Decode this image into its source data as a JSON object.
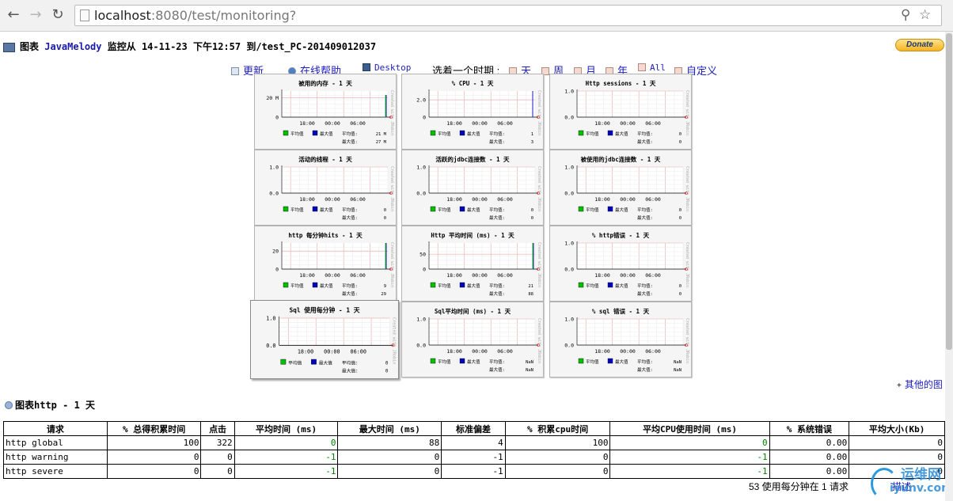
{
  "browser": {
    "url_host": "localhost",
    "url_path": ":8080/test/monitoring?"
  },
  "header": {
    "prefix": "图表",
    "app": "JavaMelody",
    "monitor_text": "监控从 14-11-23 下午12:57 到/test_PC-201409012037",
    "donate": "Donate"
  },
  "toolbar": {
    "refresh": "更新",
    "help": "在线帮助",
    "desktop": "Desktop",
    "period_label": "选着一个时期 :",
    "day": "天",
    "week": "周",
    "month": "月",
    "year": "年",
    "all": "All",
    "custom": "自定义"
  },
  "charts": [
    {
      "title": "被用的内存 - 1 天",
      "y_top": "20 M",
      "y_bottom": "0",
      "avg": "21 M",
      "max": "27 M",
      "spike": true,
      "spike_colors": [
        "#00c000",
        "#0000c0"
      ],
      "spike_height": 0.85,
      "y_top_frac": 0.74
    },
    {
      "title": "% CPU - 1 天",
      "y_top": "2.0",
      "y_bottom": "0",
      "avg": "1",
      "max": "3",
      "spike": true,
      "spike_colors": [
        "#0000c0"
      ],
      "spike_height": 1.0,
      "y_top_frac": 0.66
    },
    {
      "title": "Http sessions - 1 天",
      "y_top": "1.0",
      "y_bottom": "0.0",
      "avg": "0",
      "max": "0",
      "spike": false,
      "y_top_frac": 1.0
    },
    {
      "title": "活动的线程 - 1 天",
      "y_top": "1.0",
      "y_bottom": "0.0",
      "avg": "0",
      "max": "0",
      "spike": false,
      "y_top_frac": 1.0
    },
    {
      "title": "活跃的jdbc连接数 - 1 天",
      "y_top": "1.0",
      "y_bottom": "0.0",
      "avg": "0",
      "max": "0",
      "spike": false,
      "y_top_frac": 1.0
    },
    {
      "title": "被使用的jdbc连接数 - 1 天",
      "y_top": "1.0",
      "y_bottom": "0.0",
      "avg": "0",
      "max": "0",
      "spike": false,
      "y_top_frac": 1.0
    },
    {
      "title": "http 每分钟hits - 1 天",
      "y_top": "20",
      "y_bottom": "0",
      "avg": "9",
      "max": "29",
      "spike": true,
      "spike_colors": [
        "#00c000",
        "#0000c0"
      ],
      "spike_height": 1.0,
      "y_top_frac": 0.69
    },
    {
      "title": "Http 平均时间 (ms) - 1 天",
      "y_top": "50",
      "y_bottom": "0",
      "avg": "21",
      "max": "88",
      "spike": true,
      "spike_colors": [
        "#00c000",
        "#0000c0"
      ],
      "spike_height": 1.0,
      "y_top_frac": 0.57
    },
    {
      "title": "% http错误 - 1 天",
      "y_top": "1.0",
      "y_bottom": "0.0",
      "avg": "0",
      "max": "0",
      "spike": false,
      "y_top_frac": 1.0
    },
    {
      "title": "Sql 使用每分钟 - 1 天",
      "y_top": "1.0",
      "y_bottom": "0.0",
      "avg": "0",
      "max": "0",
      "spike": false,
      "y_top_frac": 1.0,
      "big": true
    },
    {
      "title": "Sql平均时间 (ms) - 1 天",
      "y_top": "1.0",
      "y_bottom": "0.0",
      "avg": "NaN",
      "max": "NaN",
      "spike": false,
      "y_top_frac": 1.0
    },
    {
      "title": "% sql 错误 - 1 天",
      "y_top": "1.0",
      "y_bottom": "0.0",
      "avg": "NaN",
      "max": "NaN",
      "spike": false,
      "y_top_frac": 1.0
    }
  ],
  "chart_common": {
    "x_ticks": [
      "18:00",
      "00:00",
      "06:00"
    ],
    "legend_avg": "平均值",
    "legend_max": "最大值",
    "avg_label": "平均值:",
    "max_label": "最大值:",
    "side_text": "Created with JRobin",
    "avg_color": "#00c000",
    "max_color": "#0000c0"
  },
  "other_charts": "其他的图",
  "section_title": "图表http - 1 天",
  "table": {
    "headers": [
      "请求",
      "% 总得积累时间",
      "点击",
      "平均时间 (ms)",
      "最大时间 (ms)",
      "标准偏差",
      "% 积累cpu时间",
      "平均CPU使用时间 (ms)",
      "% 系统错误",
      "平均大小(Kb)"
    ],
    "rows": [
      [
        "http global",
        "100",
        "322",
        "0",
        "88",
        "4",
        "100",
        "0",
        "0.00",
        "0"
      ],
      [
        "http warning",
        "0",
        "0",
        "-1",
        "0",
        "-1",
        "0",
        "-1",
        "0.00",
        "0"
      ],
      [
        "http severe",
        "0",
        "0",
        "-1",
        "0",
        "-1",
        "0",
        "-1",
        "0.00",
        "0"
      ]
    ]
  },
  "footer": {
    "note": "53 使用每分钟在 1 请求",
    "link": "描述"
  },
  "watermark": {
    "cn": "运维网",
    "en": "iyunv.com"
  }
}
